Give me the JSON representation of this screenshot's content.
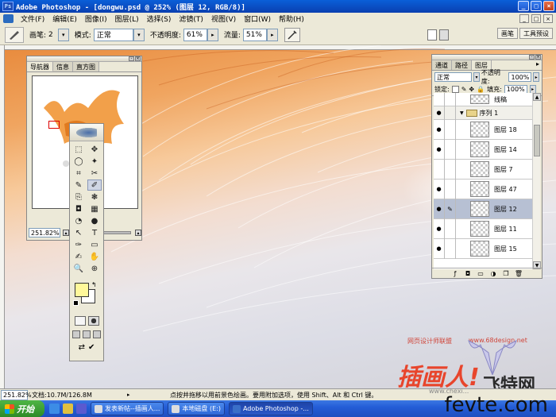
{
  "title_bar": {
    "app_icon": "photoshop-app-icon",
    "title": "Adobe Photoshop - [dongwu.psd @ 252% (图层 12, RGB/8)]",
    "buttons": [
      "_",
      "□",
      "×"
    ]
  },
  "menu": {
    "items": [
      "文件(F)",
      "编辑(E)",
      "图像(I)",
      "图层(L)",
      "选择(S)",
      "滤镜(T)",
      "视图(V)",
      "窗口(W)",
      "帮助(H)"
    ],
    "mdi_buttons": [
      "_",
      "□",
      "×"
    ]
  },
  "options_bar": {
    "brush_label": "画笔:",
    "brush_size": "2",
    "mode_label": "模式:",
    "mode_value": "正常",
    "opacity_label": "不透明度:",
    "opacity_value": "61%",
    "flow_label": "流量:",
    "flow_value": "51%",
    "palette_well": [
      "画笔",
      "工具预设"
    ]
  },
  "navigator": {
    "tabs": [
      "导航器",
      "信息",
      "直方图"
    ],
    "zoom": "251.82%"
  },
  "toolbox": {
    "tools": [
      "⬚",
      "✥",
      "◯",
      "✦",
      "⌗",
      "✂",
      "✎",
      "✐",
      "⎘",
      "❃",
      "◘",
      "▦",
      "◔",
      "●",
      "↖",
      "T",
      "✑",
      "▭",
      "✍",
      "✋",
      "🔍",
      "⊕"
    ],
    "foreground_color": "#fff89a",
    "background_color": "#ffffff"
  },
  "layers": {
    "tabs": [
      "通道",
      "路径",
      "图层"
    ],
    "blend_mode": "正常",
    "opacity_label": "不透明度:",
    "opacity_value": "100%",
    "lock_label": "锁定:",
    "fill_label": "填充:",
    "fill_value": "100%",
    "items": [
      {
        "name": "线稿",
        "visible": false,
        "type": "layer"
      },
      {
        "name": "序列 1",
        "visible": true,
        "type": "group"
      },
      {
        "name": "图层 18",
        "visible": true,
        "type": "layer"
      },
      {
        "name": "图层 14",
        "visible": true,
        "type": "layer"
      },
      {
        "name": "图层 7",
        "visible": false,
        "type": "layer"
      },
      {
        "name": "图层 47",
        "visible": true,
        "type": "layer"
      },
      {
        "name": "图层 12",
        "visible": true,
        "type": "layer",
        "selected": true
      },
      {
        "name": "图层 11",
        "visible": true,
        "type": "layer"
      },
      {
        "name": "图层 15",
        "visible": true,
        "type": "layer"
      }
    ]
  },
  "status_bar": {
    "zoom": "251.82%",
    "doc": "文档:10.7M/126.8M",
    "hint": "点按并拖移以用前景色绘画。要用附加选项，使用 Shift、Alt 和 Ctrl 键。"
  },
  "taskbar": {
    "start": "开始",
    "tasks": [
      "发表新帖--插画人...",
      "本地磁盘 (E:)",
      "Adobe Photoshop -..."
    ]
  },
  "watermarks": {
    "site_cn": "网页设计师联盟",
    "site_url": "www.68design.net",
    "big_text": "插画人!",
    "flying": "飞特网",
    "fevte": "fevte.com",
    "faint": "www.chexi..."
  }
}
